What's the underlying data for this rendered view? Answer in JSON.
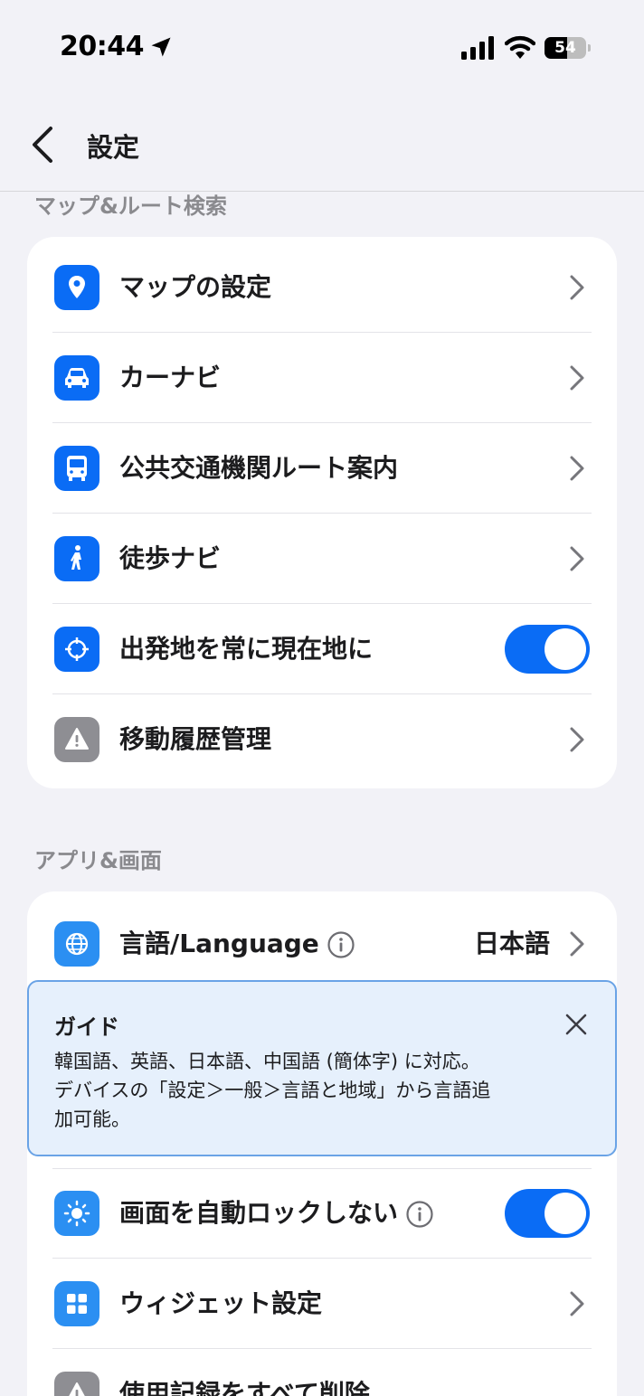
{
  "status_bar": {
    "time": "20:44",
    "battery": "54",
    "battery_level": 0.54
  },
  "nav": {
    "title": "設定"
  },
  "sections": {
    "maps": {
      "header": "マップ&ルート検索",
      "items": [
        {
          "label": "マップの設定",
          "icon": "map-pin-icon"
        },
        {
          "label": "カーナビ",
          "icon": "car-icon"
        },
        {
          "label": "公共交通機関ルート案内",
          "icon": "bus-icon"
        },
        {
          "label": "徒歩ナビ",
          "icon": "walking-icon"
        },
        {
          "label": "出発地を常に現在地に",
          "icon": "crosshair-icon",
          "toggle": true
        },
        {
          "label": "移動履歴管理",
          "icon": "warning-icon"
        }
      ]
    },
    "app": {
      "header": "アプリ&画面",
      "items": [
        {
          "label": "言語/Language",
          "icon": "globe-icon",
          "value": "日本語"
        },
        {
          "label": "画面を自動ロックしない",
          "icon": "brightness-icon",
          "toggle": true
        },
        {
          "label": "ウィジェット設定",
          "icon": "widget-grid-icon"
        },
        {
          "label": "使用記録をすべて削除",
          "icon": "warning-icon"
        }
      ]
    }
  },
  "guide": {
    "title": "ガイド",
    "line1": "韓国語、英語、日本語、中国語 (簡体字) に対応。",
    "line2": "デバイスの「設定＞一般＞言語と地域」から言語追",
    "line3": "加可能。"
  },
  "colors": {
    "accent": "#0a6cf5",
    "icon_light_blue": "#2b8ff2",
    "icon_gray": "#8e8e93",
    "background": "#f2f2f7"
  }
}
